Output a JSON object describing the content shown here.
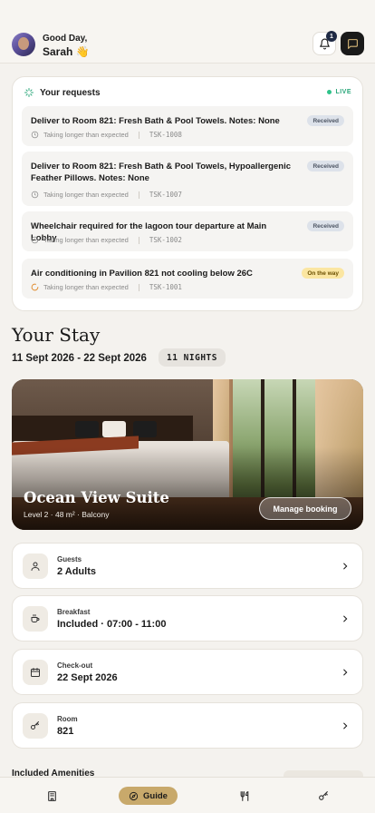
{
  "header": {
    "greeting": "Good Day,",
    "user_name": "Sarah 👋",
    "notification_count": "1"
  },
  "requests": {
    "title": "Your requests",
    "live_label": "LIVE",
    "items": [
      {
        "text": "Deliver to Room 821: Fresh Bath & Pool Towels. Notes: None",
        "status": "Received",
        "timing": "Taking longer than expected",
        "code": "TSK-1008"
      },
      {
        "text": "Deliver to Room 821: Fresh Bath & Pool Towels, Hypoallergenic Feather Pillows. Notes: None",
        "status": "Received",
        "timing": "Taking longer than expected",
        "code": "TSK-1007"
      },
      {
        "text": "Wheelchair required for the lagoon tour departure at Main Lobby",
        "status": "Received",
        "timing": "Taking longer than expected",
        "code": "TSK-1002"
      },
      {
        "text": "Air conditioning in Pavilion 821 not cooling below 26C",
        "status": "On the way",
        "timing": "Taking longer than expected",
        "code": "TSK-1001"
      }
    ]
  },
  "stay": {
    "title": "Your Stay",
    "dates": "11 Sept 2026 - 22 Sept 2026",
    "nights": "11 NIGHTS",
    "room_name": "Ocean View Suite",
    "room_details": "Level 2 · 48 m² · Balcony",
    "manage_label": "Manage booking"
  },
  "info_rows": [
    {
      "label": "Guests",
      "value": "2 Adults",
      "icon": "person-icon"
    },
    {
      "label": "Breakfast",
      "value": "Included · 07:00 - 11:00",
      "icon": "coffee-icon"
    },
    {
      "label": "Check-out",
      "value": "22 Sept 2026",
      "icon": "calendar-icon"
    },
    {
      "label": "Room",
      "value": "821",
      "icon": "key-icon"
    }
  ],
  "amenities_title": "Included Amenities",
  "nav": {
    "guide_label": "Guide"
  },
  "colors": {
    "accent": "#c8a96b",
    "live": "#2fc38a",
    "received_pill": "#dde2ea",
    "onway_pill": "#fbe6a2",
    "background": "#f4f2ee"
  }
}
